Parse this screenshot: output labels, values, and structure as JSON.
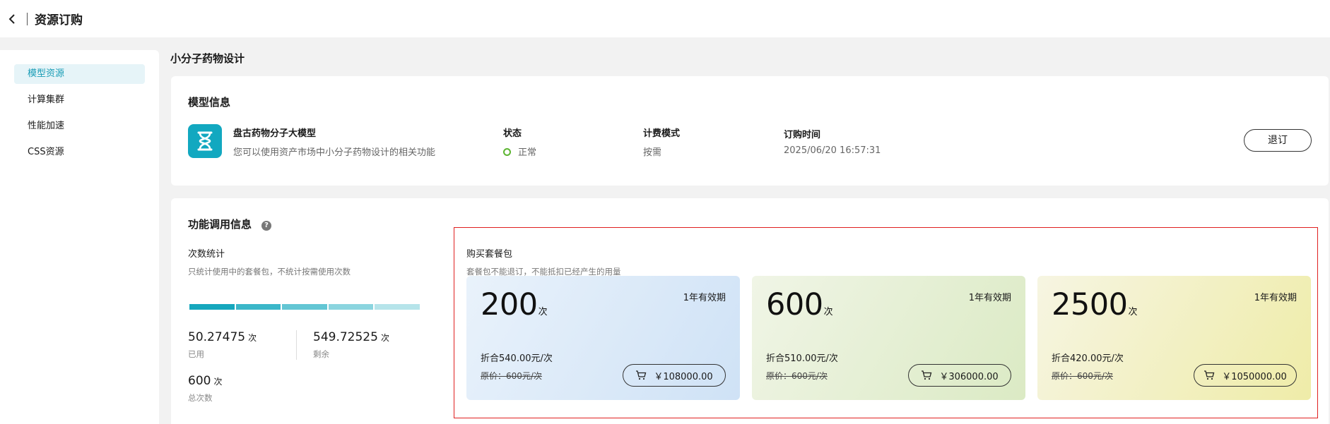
{
  "header": {
    "title": "资源订购"
  },
  "sidebar": {
    "items": [
      {
        "label": "模型资源",
        "active": true
      },
      {
        "label": "计算集群",
        "active": false
      },
      {
        "label": "性能加速",
        "active": false
      },
      {
        "label": "CSS资源",
        "active": false
      }
    ]
  },
  "page": {
    "title": "小分子药物设计"
  },
  "model_info": {
    "heading": "模型信息",
    "product_name": "盘古药物分子大模型",
    "product_desc": "您可以使用资产市场中小分子药物设计的相关功能",
    "icon": "hourglass-icon",
    "status_label": "状态",
    "status_value": "正常",
    "status_color": "#5cb531",
    "billing_label": "计费模式",
    "billing_value": "按需",
    "order_time_label": "订购时间",
    "order_time_value": "2025/06/20 16:57:31",
    "unsubscribe_label": "退订"
  },
  "usage": {
    "heading": "功能调用信息",
    "help_icon": "?",
    "count_title": "次数统计",
    "count_note": "只统计使用中的套餐包，不统计按需使用次数",
    "used_value": "50.27475",
    "used_unit": "次",
    "used_label": "已用",
    "remaining_value": "549.72525",
    "remaining_unit": "次",
    "remaining_label": "剩余",
    "total_value": "600",
    "total_unit": "次",
    "total_label": "总次数",
    "bar_colors": [
      "#16a7bd",
      "#3bb7c9",
      "#63c6d4",
      "#8bd5df",
      "#b6e4ea"
    ]
  },
  "packages": {
    "title": "购买套餐包",
    "note": "套餐包不能退订，不能抵扣已经产生的用量",
    "items": [
      {
        "count": "200",
        "unit": "次",
        "validity": "1年有效期",
        "discount": "折合540.00元/次",
        "original": "原价：600元/次",
        "price": "￥108000.00"
      },
      {
        "count": "600",
        "unit": "次",
        "validity": "1年有效期",
        "discount": "折合510.00元/次",
        "original": "原价：600元/次",
        "price": "￥306000.00"
      },
      {
        "count": "2500",
        "unit": "次",
        "validity": "1年有效期",
        "discount": "折合420.00元/次",
        "original": "原价：600元/次",
        "price": "￥1050000.00"
      }
    ]
  }
}
